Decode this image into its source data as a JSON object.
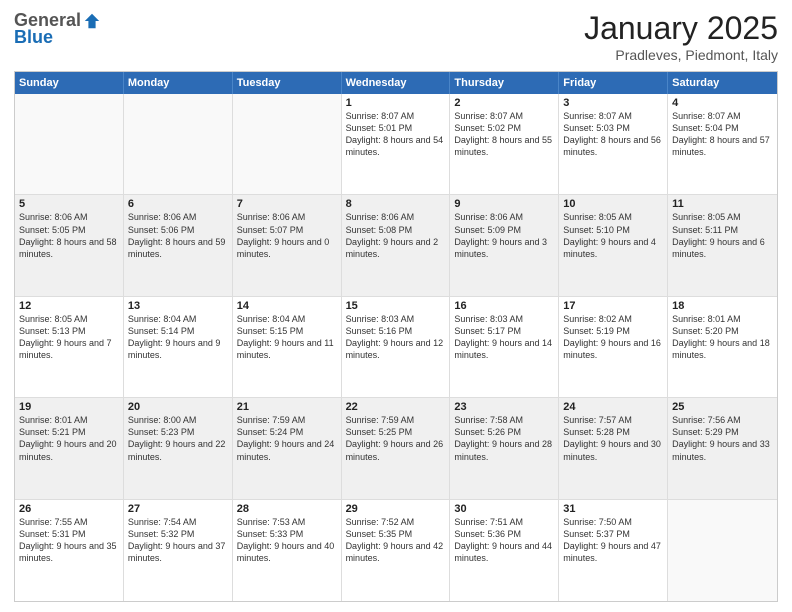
{
  "header": {
    "logo": {
      "general": "General",
      "blue": "Blue"
    },
    "title": "January 2025",
    "subtitle": "Pradleves, Piedmont, Italy"
  },
  "weekdays": [
    "Sunday",
    "Monday",
    "Tuesday",
    "Wednesday",
    "Thursday",
    "Friday",
    "Saturday"
  ],
  "weeks": [
    [
      {
        "date": "",
        "sunrise": "",
        "sunset": "",
        "daylight": ""
      },
      {
        "date": "",
        "sunrise": "",
        "sunset": "",
        "daylight": ""
      },
      {
        "date": "",
        "sunrise": "",
        "sunset": "",
        "daylight": ""
      },
      {
        "date": "1",
        "sunrise": "Sunrise: 8:07 AM",
        "sunset": "Sunset: 5:01 PM",
        "daylight": "Daylight: 8 hours and 54 minutes."
      },
      {
        "date": "2",
        "sunrise": "Sunrise: 8:07 AM",
        "sunset": "Sunset: 5:02 PM",
        "daylight": "Daylight: 8 hours and 55 minutes."
      },
      {
        "date": "3",
        "sunrise": "Sunrise: 8:07 AM",
        "sunset": "Sunset: 5:03 PM",
        "daylight": "Daylight: 8 hours and 56 minutes."
      },
      {
        "date": "4",
        "sunrise": "Sunrise: 8:07 AM",
        "sunset": "Sunset: 5:04 PM",
        "daylight": "Daylight: 8 hours and 57 minutes."
      }
    ],
    [
      {
        "date": "5",
        "sunrise": "Sunrise: 8:06 AM",
        "sunset": "Sunset: 5:05 PM",
        "daylight": "Daylight: 8 hours and 58 minutes."
      },
      {
        "date": "6",
        "sunrise": "Sunrise: 8:06 AM",
        "sunset": "Sunset: 5:06 PM",
        "daylight": "Daylight: 8 hours and 59 minutes."
      },
      {
        "date": "7",
        "sunrise": "Sunrise: 8:06 AM",
        "sunset": "Sunset: 5:07 PM",
        "daylight": "Daylight: 9 hours and 0 minutes."
      },
      {
        "date": "8",
        "sunrise": "Sunrise: 8:06 AM",
        "sunset": "Sunset: 5:08 PM",
        "daylight": "Daylight: 9 hours and 2 minutes."
      },
      {
        "date": "9",
        "sunrise": "Sunrise: 8:06 AM",
        "sunset": "Sunset: 5:09 PM",
        "daylight": "Daylight: 9 hours and 3 minutes."
      },
      {
        "date": "10",
        "sunrise": "Sunrise: 8:05 AM",
        "sunset": "Sunset: 5:10 PM",
        "daylight": "Daylight: 9 hours and 4 minutes."
      },
      {
        "date": "11",
        "sunrise": "Sunrise: 8:05 AM",
        "sunset": "Sunset: 5:11 PM",
        "daylight": "Daylight: 9 hours and 6 minutes."
      }
    ],
    [
      {
        "date": "12",
        "sunrise": "Sunrise: 8:05 AM",
        "sunset": "Sunset: 5:13 PM",
        "daylight": "Daylight: 9 hours and 7 minutes."
      },
      {
        "date": "13",
        "sunrise": "Sunrise: 8:04 AM",
        "sunset": "Sunset: 5:14 PM",
        "daylight": "Daylight: 9 hours and 9 minutes."
      },
      {
        "date": "14",
        "sunrise": "Sunrise: 8:04 AM",
        "sunset": "Sunset: 5:15 PM",
        "daylight": "Daylight: 9 hours and 11 minutes."
      },
      {
        "date": "15",
        "sunrise": "Sunrise: 8:03 AM",
        "sunset": "Sunset: 5:16 PM",
        "daylight": "Daylight: 9 hours and 12 minutes."
      },
      {
        "date": "16",
        "sunrise": "Sunrise: 8:03 AM",
        "sunset": "Sunset: 5:17 PM",
        "daylight": "Daylight: 9 hours and 14 minutes."
      },
      {
        "date": "17",
        "sunrise": "Sunrise: 8:02 AM",
        "sunset": "Sunset: 5:19 PM",
        "daylight": "Daylight: 9 hours and 16 minutes."
      },
      {
        "date": "18",
        "sunrise": "Sunrise: 8:01 AM",
        "sunset": "Sunset: 5:20 PM",
        "daylight": "Daylight: 9 hours and 18 minutes."
      }
    ],
    [
      {
        "date": "19",
        "sunrise": "Sunrise: 8:01 AM",
        "sunset": "Sunset: 5:21 PM",
        "daylight": "Daylight: 9 hours and 20 minutes."
      },
      {
        "date": "20",
        "sunrise": "Sunrise: 8:00 AM",
        "sunset": "Sunset: 5:23 PM",
        "daylight": "Daylight: 9 hours and 22 minutes."
      },
      {
        "date": "21",
        "sunrise": "Sunrise: 7:59 AM",
        "sunset": "Sunset: 5:24 PM",
        "daylight": "Daylight: 9 hours and 24 minutes."
      },
      {
        "date": "22",
        "sunrise": "Sunrise: 7:59 AM",
        "sunset": "Sunset: 5:25 PM",
        "daylight": "Daylight: 9 hours and 26 minutes."
      },
      {
        "date": "23",
        "sunrise": "Sunrise: 7:58 AM",
        "sunset": "Sunset: 5:26 PM",
        "daylight": "Daylight: 9 hours and 28 minutes."
      },
      {
        "date": "24",
        "sunrise": "Sunrise: 7:57 AM",
        "sunset": "Sunset: 5:28 PM",
        "daylight": "Daylight: 9 hours and 30 minutes."
      },
      {
        "date": "25",
        "sunrise": "Sunrise: 7:56 AM",
        "sunset": "Sunset: 5:29 PM",
        "daylight": "Daylight: 9 hours and 33 minutes."
      }
    ],
    [
      {
        "date": "26",
        "sunrise": "Sunrise: 7:55 AM",
        "sunset": "Sunset: 5:31 PM",
        "daylight": "Daylight: 9 hours and 35 minutes."
      },
      {
        "date": "27",
        "sunrise": "Sunrise: 7:54 AM",
        "sunset": "Sunset: 5:32 PM",
        "daylight": "Daylight: 9 hours and 37 minutes."
      },
      {
        "date": "28",
        "sunrise": "Sunrise: 7:53 AM",
        "sunset": "Sunset: 5:33 PM",
        "daylight": "Daylight: 9 hours and 40 minutes."
      },
      {
        "date": "29",
        "sunrise": "Sunrise: 7:52 AM",
        "sunset": "Sunset: 5:35 PM",
        "daylight": "Daylight: 9 hours and 42 minutes."
      },
      {
        "date": "30",
        "sunrise": "Sunrise: 7:51 AM",
        "sunset": "Sunset: 5:36 PM",
        "daylight": "Daylight: 9 hours and 44 minutes."
      },
      {
        "date": "31",
        "sunrise": "Sunrise: 7:50 AM",
        "sunset": "Sunset: 5:37 PM",
        "daylight": "Daylight: 9 hours and 47 minutes."
      },
      {
        "date": "",
        "sunrise": "",
        "sunset": "",
        "daylight": ""
      }
    ]
  ]
}
